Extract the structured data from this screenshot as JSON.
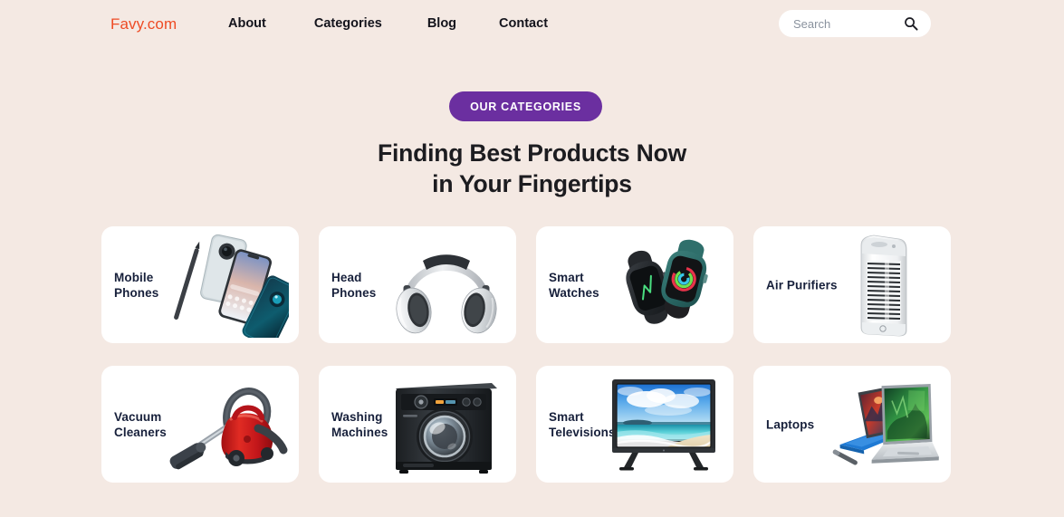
{
  "header": {
    "logo": "Favy.com",
    "nav": [
      {
        "label": "About"
      },
      {
        "label": "Categories"
      },
      {
        "label": "Blog"
      },
      {
        "label": "Contact"
      }
    ],
    "search": {
      "placeholder": "Search",
      "value": "",
      "icon": "search-icon"
    }
  },
  "section": {
    "badge_label": "OUR CATEGORIES",
    "heading_line1": "Finding Best Products Now",
    "heading_line2": "in Your Fingertips"
  },
  "categories": [
    {
      "label_line1": "Mobile",
      "label_line2": "Phones",
      "art": "mobile-phones-image"
    },
    {
      "label_line1": "Head",
      "label_line2": "Phones",
      "art": "headphones-image"
    },
    {
      "label_line1": "Smart",
      "label_line2": "Watches",
      "art": "smart-watches-image"
    },
    {
      "label_line1": "Air Purifiers",
      "label_line2": "",
      "art": "air-purifier-image"
    },
    {
      "label_line1": "Vacuum",
      "label_line2": "Cleaners",
      "art": "vacuum-cleaner-image"
    },
    {
      "label_line1": "Washing",
      "label_line2": "Machines",
      "art": "washing-machine-image"
    },
    {
      "label_line1": "Smart",
      "label_line2": "Televisions",
      "art": "smart-television-image"
    },
    {
      "label_line1": "Laptops",
      "label_line2": "",
      "art": "laptops-image"
    }
  ],
  "colors": {
    "background": "#F4E9E3",
    "card": "#FFFFFF",
    "logo": "#EE4B24",
    "badge": "#6B2FA0",
    "heading": "#1C1C20",
    "card_label": "#17203B"
  }
}
